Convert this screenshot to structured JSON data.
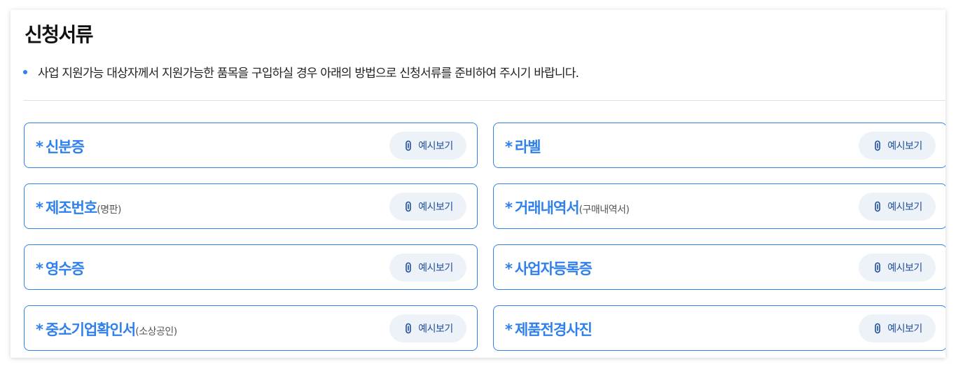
{
  "section": {
    "title": "신청서류",
    "notice": "사업 지원가능 대상자께서 지원가능한 품목을 구입하실 경우 아래의 방법으로 신청서류를 준비하여 주시기 바랍니다."
  },
  "colors": {
    "accent": "#2f80ed",
    "button_bg": "#edf2f9",
    "button_text": "#1f4f9c"
  },
  "documents": [
    {
      "required_mark": "*",
      "name": "신분증",
      "note": "",
      "button_label": "예시보기",
      "button_icon": "paperclip-icon"
    },
    {
      "required_mark": "*",
      "name": "라벨",
      "note": "",
      "button_label": "예시보기",
      "button_icon": "paperclip-icon"
    },
    {
      "required_mark": "*",
      "name": "제조번호",
      "note": "(명판)",
      "button_label": "예시보기",
      "button_icon": "paperclip-icon"
    },
    {
      "required_mark": "*",
      "name": "거래내역서",
      "note": "(구매내역서)",
      "button_label": "예시보기",
      "button_icon": "paperclip-icon"
    },
    {
      "required_mark": "*",
      "name": "영수증",
      "note": "",
      "button_label": "예시보기",
      "button_icon": "paperclip-icon"
    },
    {
      "required_mark": "*",
      "name": "사업자등록증",
      "note": "",
      "button_label": "예시보기",
      "button_icon": "paperclip-icon"
    },
    {
      "required_mark": "*",
      "name": "중소기업확인서",
      "note": "(소상공인)",
      "button_label": "예시보기",
      "button_icon": "paperclip-icon"
    },
    {
      "required_mark": "*",
      "name": "제품전경사진",
      "note": "",
      "button_label": "예시보기",
      "button_icon": "paperclip-icon"
    }
  ]
}
